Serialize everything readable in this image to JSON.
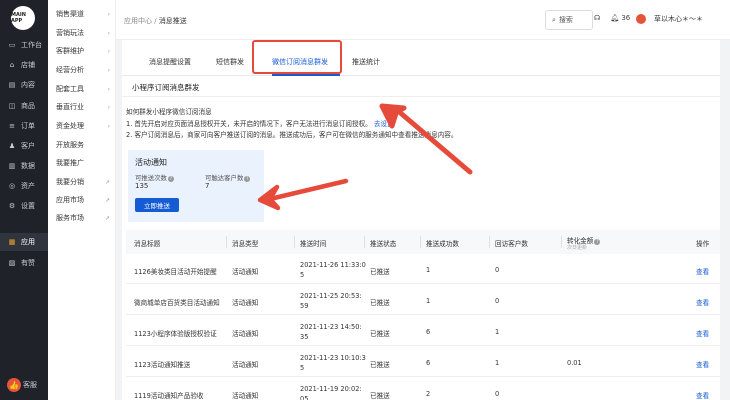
{
  "sidebar": {
    "logo_text": "MAIN APP",
    "items": [
      {
        "icon": "desktop-icon",
        "glyph": "▭",
        "label": "工作台"
      },
      {
        "icon": "shop-icon",
        "glyph": "⌂",
        "label": "店铺"
      },
      {
        "icon": "content-icon",
        "glyph": "▤",
        "label": "内容"
      },
      {
        "icon": "goods-icon",
        "glyph": "◫",
        "label": "商品"
      },
      {
        "icon": "order-icon",
        "glyph": "≡",
        "label": "订单"
      },
      {
        "icon": "customer-icon",
        "glyph": "♟",
        "label": "客户"
      },
      {
        "icon": "data-icon",
        "glyph": "▥",
        "label": "数据"
      },
      {
        "icon": "asset-icon",
        "glyph": "◎",
        "label": "资产"
      },
      {
        "icon": "settings-icon",
        "glyph": "⚙",
        "label": "设置"
      },
      {
        "icon": "apps-icon",
        "glyph": "▦",
        "label": "应用"
      },
      {
        "icon": "praise-icon",
        "glyph": "▨",
        "label": "有赞"
      }
    ],
    "service_label": "客服"
  },
  "subnav": {
    "items": [
      {
        "label": "销售渠道",
        "arrow": "›"
      },
      {
        "label": "营销玩法",
        "arrow": "›"
      },
      {
        "label": "客群维护",
        "arrow": "›"
      },
      {
        "label": "经营分析",
        "arrow": "›"
      },
      {
        "label": "配套工具",
        "arrow": "›"
      },
      {
        "label": "垂直行业",
        "arrow": "›"
      },
      {
        "label": "资金处理",
        "arrow": "›"
      },
      {
        "label": "开放服务",
        "arrow": ""
      },
      {
        "label": "我要推广",
        "arrow": ""
      },
      {
        "label": "我要分销",
        "arrow": "↗"
      },
      {
        "label": "应用市场",
        "arrow": "↗"
      },
      {
        "label": "服务市场",
        "arrow": "↗"
      }
    ]
  },
  "header": {
    "crumb_parent": "应用中心",
    "crumb_sep": " / ",
    "crumb_current": "消息推送",
    "search_label": "搜索",
    "notification_count": "36",
    "user_name": "草以木心＊～＊"
  },
  "tabs": [
    {
      "label": "消息提醒设置"
    },
    {
      "label": "短信群发"
    },
    {
      "label": "微信订阅消息群发"
    },
    {
      "label": "推送统计"
    }
  ],
  "section_title": "小程序订阅消息群发",
  "description": {
    "heading": "如何群发小程序微信订阅消息",
    "step1": "1. 首先开启对应页面消息授权开关，未开启的情况下，客户无法进行消息订阅授权。",
    "step1_link": "去设置",
    "step2": "2. 客户订阅消息后，商家可向客户推送订阅的消息。推送成功后，客户可在微信的服务通知中查看推送消息内容。"
  },
  "activity": {
    "title": "活动通知",
    "push_label": "可推送次数",
    "push_value": "135",
    "reach_label": "可触达客户数",
    "reach_value": "7",
    "button": "立即推送"
  },
  "table": {
    "headers": [
      "消息标题",
      "消息类型",
      "推送时间",
      "推送状态",
      "推送成功数",
      "回访客户数",
      "转化金额",
      "操作"
    ],
    "conversion_note": "次日更新",
    "rows": [
      {
        "title": "1126美妆类目活动开始提醒",
        "type": "活动通知",
        "time_line1": "2021-11-26 11:33:0",
        "time_line2": "5",
        "status": "已推送",
        "success": "1",
        "visitors": "0",
        "amount": "",
        "action": "查看"
      },
      {
        "title": "微商城单店百货类目活动通知",
        "type": "活动通知",
        "time_line1": "2021-11-25 20:53:",
        "time_line2": "59",
        "status": "已推送",
        "success": "1",
        "visitors": "0",
        "amount": "",
        "action": "查看"
      },
      {
        "title": "1123小程序体验版授权验证",
        "type": "活动通知",
        "time_line1": "2021-11-23 14:50:",
        "time_line2": "35",
        "status": "已推送",
        "success": "6",
        "visitors": "1",
        "amount": "",
        "action": "查看"
      },
      {
        "title": "1123活动通知推送",
        "type": "活动通知",
        "time_line1": "2021-11-23 10:10:3",
        "time_line2": "5",
        "status": "已推送",
        "success": "6",
        "visitors": "1",
        "amount": "0.01",
        "action": "查看"
      },
      {
        "title": "1119活动通知产品验收",
        "type": "活动通知",
        "time_line1": "2021-11-19 20:02:",
        "time_line2": "05",
        "status": "已推送",
        "success": "2",
        "visitors": "0",
        "amount": "",
        "action": "查看"
      }
    ]
  },
  "colors": {
    "accent": "#155bd4",
    "annotation_red": "#e64a3b",
    "sidebar_bg": "#1f2229"
  }
}
